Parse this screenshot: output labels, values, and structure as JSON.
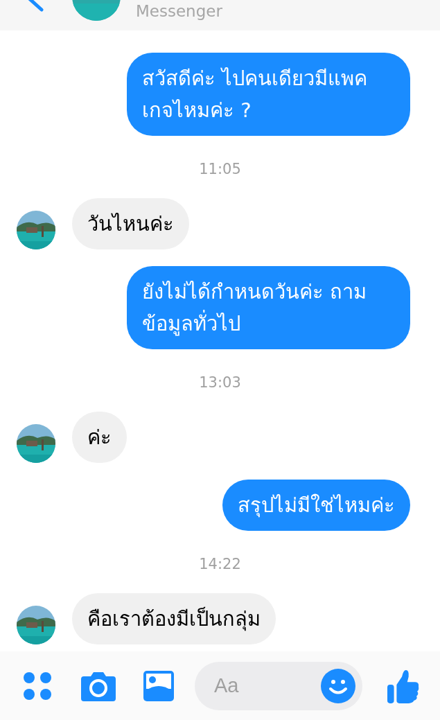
{
  "header": {
    "title": "Messenger"
  },
  "messages": [
    {
      "kind": "outgoing",
      "text": "สวัสดีค่ะ ไปคนเดียวมีแพคเกจไหมค่ะ ?"
    },
    {
      "kind": "time",
      "text": "11:05"
    },
    {
      "kind": "incoming",
      "text": "วันไหนค่ะ"
    },
    {
      "kind": "outgoing",
      "text": "ยังไม่ได้กำหนดวันค่ะ ถามข้อมูลทั่วไป"
    },
    {
      "kind": "time",
      "text": "13:03"
    },
    {
      "kind": "incoming",
      "text": "ค่ะ"
    },
    {
      "kind": "outgoing",
      "text": "สรุปไม่มีใช่ไหมค่ะ"
    },
    {
      "kind": "time",
      "text": "14:22"
    },
    {
      "kind": "incoming",
      "text": "คือเราต้องมีเป็นกลุ่ม"
    }
  ],
  "composer": {
    "placeholder": "Aa"
  }
}
